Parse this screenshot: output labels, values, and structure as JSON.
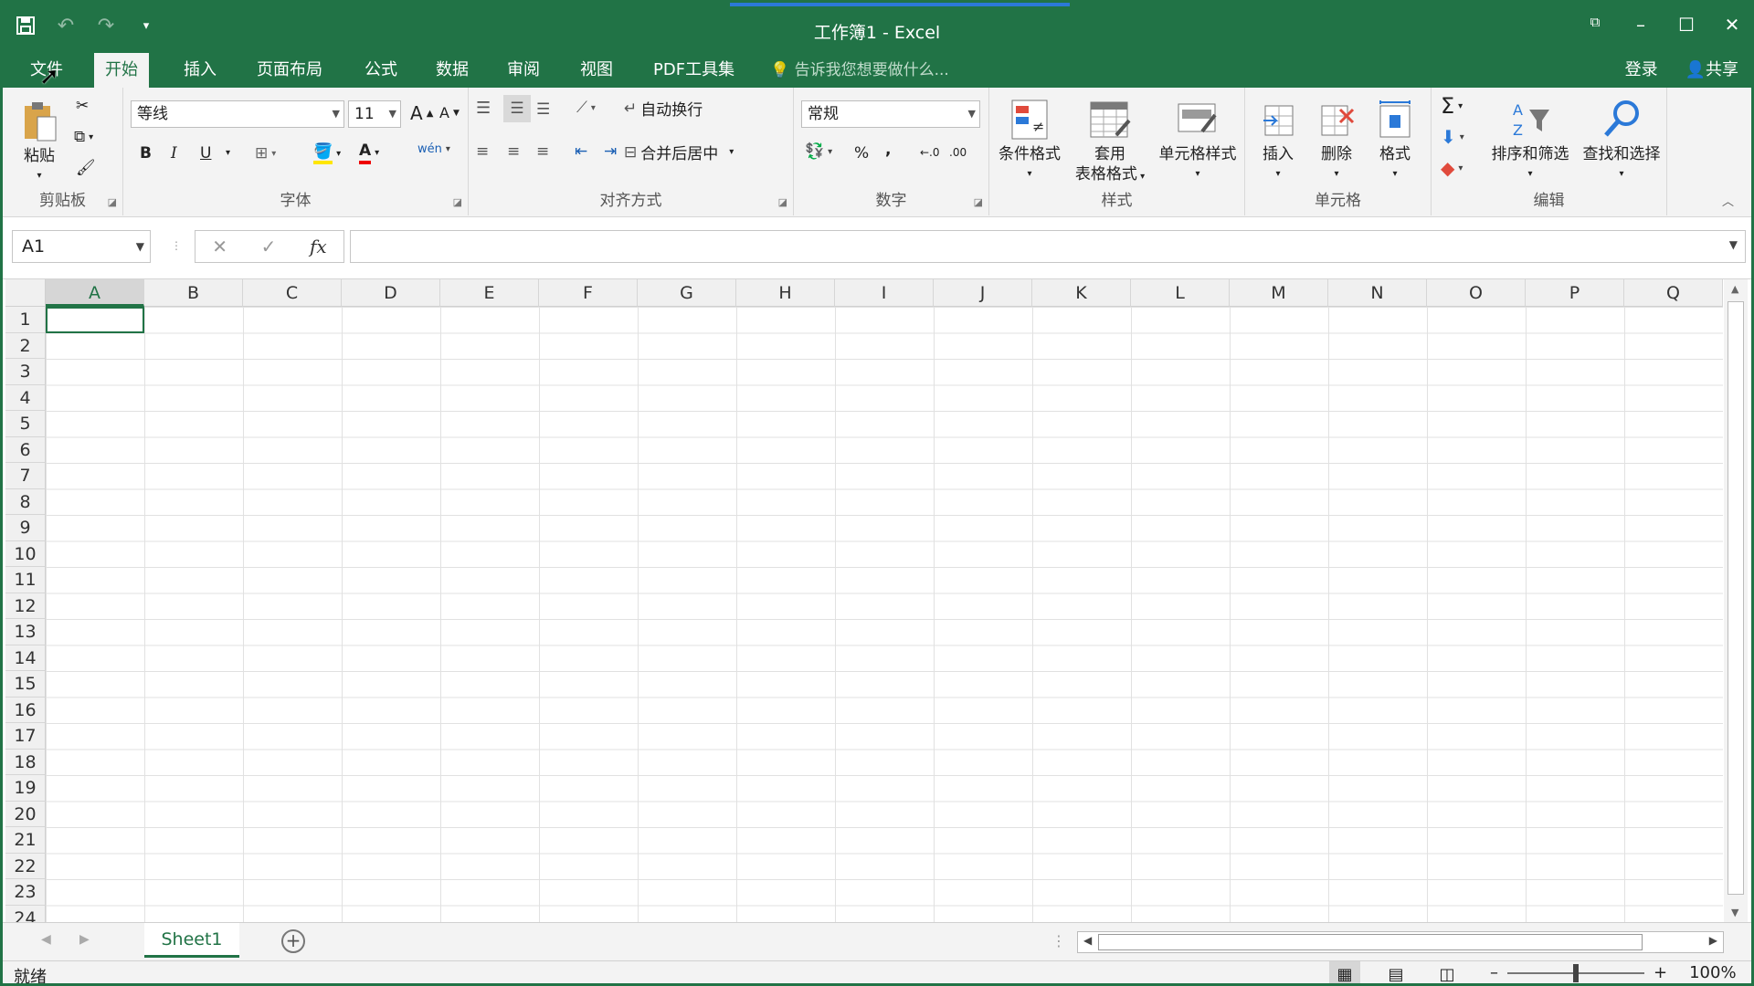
{
  "window": {
    "title": "工作簿1 - Excel",
    "accent_color": "#217346"
  },
  "tabs": [
    {
      "label": "文件"
    },
    {
      "label": "开始"
    },
    {
      "label": "插入"
    },
    {
      "label": "页面布局"
    },
    {
      "label": "公式"
    },
    {
      "label": "数据"
    },
    {
      "label": "审阅"
    },
    {
      "label": "视图"
    },
    {
      "label": "PDF工具集"
    }
  ],
  "tellme": "告诉我您想要做什么...",
  "account": {
    "login": "登录",
    "share": "共享"
  },
  "ribbon": {
    "clipboard": {
      "label": "剪贴板",
      "paste": "粘贴"
    },
    "font": {
      "label": "字体",
      "name": "等线",
      "size": "11",
      "bold": "B",
      "italic": "I",
      "underline": "U",
      "grow": "A",
      "shrink": "A",
      "color": "A"
    },
    "alignment": {
      "label": "对齐方式",
      "wrap": "自动换行",
      "merge": "合并后居中"
    },
    "number": {
      "label": "数字",
      "format": "常规",
      "percent": "%",
      "comma": ","
    },
    "styles": {
      "label": "样式",
      "conditional": "条件格式",
      "table_1": "套用",
      "table_2": "表格格式",
      "cell_styles": "单元格样式"
    },
    "cells": {
      "label": "单元格",
      "insert": "插入",
      "delete": "删除",
      "format": "格式"
    },
    "editing": {
      "label": "编辑",
      "sort": "排序和筛选",
      "find": "查找和选择"
    }
  },
  "formula_bar": {
    "namebox": "A1",
    "fx": "fx",
    "value": ""
  },
  "columns": [
    "A",
    "B",
    "C",
    "D",
    "E",
    "F",
    "G",
    "H",
    "I",
    "J",
    "K",
    "L",
    "M",
    "N",
    "O",
    "P",
    "Q"
  ],
  "rows": [
    "1",
    "2",
    "3",
    "4",
    "5",
    "6",
    "7",
    "8",
    "9",
    "10",
    "11",
    "12",
    "13",
    "14",
    "15",
    "16",
    "17",
    "18",
    "19",
    "20",
    "21",
    "22",
    "23",
    "24"
  ],
  "sheet": {
    "name": "Sheet1"
  },
  "status": {
    "text": "就绪",
    "zoom": "100%"
  }
}
